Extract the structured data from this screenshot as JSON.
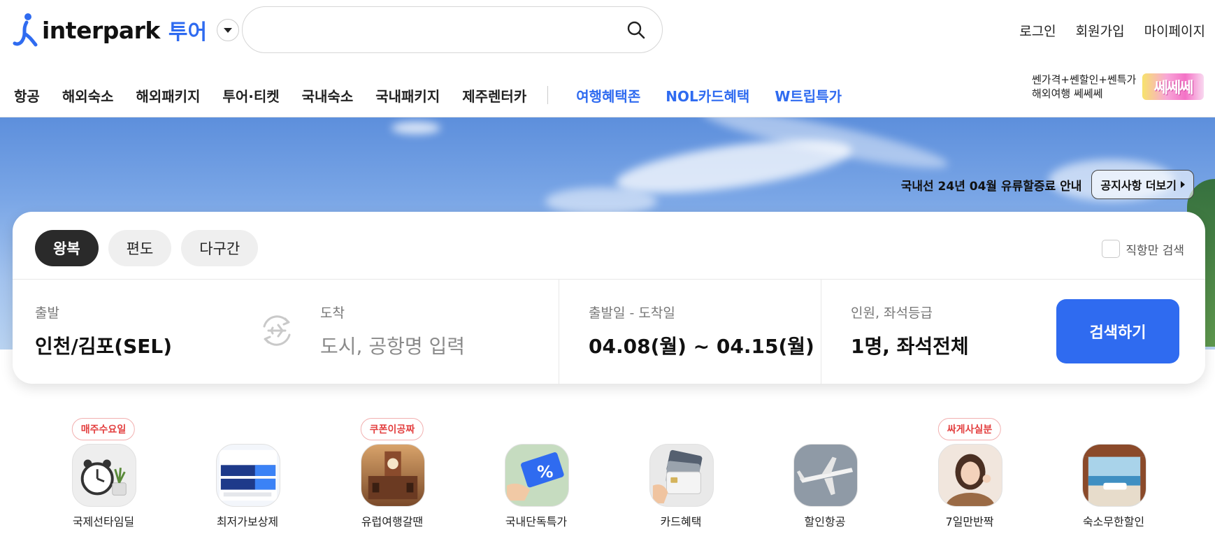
{
  "header": {
    "logo_text": "interpark",
    "logo_sub": "투어",
    "search_placeholder": "",
    "user_links": [
      "로그인",
      "회원가입",
      "마이페이지"
    ]
  },
  "nav": {
    "items": [
      "항공",
      "해외숙소",
      "해외패키지",
      "투어·티켓",
      "국내숙소",
      "국내패키지",
      "제주렌터카"
    ],
    "highlight_items": [
      "여행혜택존",
      "NOL카드혜택",
      "W트립특가"
    ],
    "promo_line1": "쎈가격+쎈할인+쎈특가",
    "promo_line2": "해외여행 쎄쎄쎄",
    "promo_badge": "쎄쎄쎄"
  },
  "notice": {
    "text": "국내선 24년 04월 유류할증료 안내",
    "button": "공지사항 더보기"
  },
  "search_panel": {
    "tabs": [
      "왕복",
      "편도",
      "다구간"
    ],
    "active_tab": "왕복",
    "direct_only": "직항만 검색",
    "departure_label": "출발",
    "departure_value": "인천/김포(SEL)",
    "arrival_label": "도착",
    "arrival_placeholder": "도시, 공항명 입력",
    "dates_label": "출발일 - 도착일",
    "dates_value": "04.08(월) ~ 04.15(월)",
    "passengers_label": "인원, 좌석등급",
    "passengers_value": "1명, 좌석전체",
    "search_button": "검색하기"
  },
  "quick_menu": [
    {
      "label": "국제선타임딜",
      "badge": "매주수요일"
    },
    {
      "label": "최저가보상제",
      "badge": ""
    },
    {
      "label": "유럽여행갈땐",
      "badge": "쿠폰이공짜"
    },
    {
      "label": "국내단독특가",
      "badge": ""
    },
    {
      "label": "카드혜택",
      "badge": ""
    },
    {
      "label": "할인항공",
      "badge": ""
    },
    {
      "label": "7일만반짝",
      "badge": "싸게사실분"
    },
    {
      "label": "숙소무한할인",
      "badge": ""
    }
  ],
  "colors": {
    "brand_blue": "#2f6bf0",
    "active_tab": "#2a2a2a",
    "badge_red": "#e34040"
  },
  "icons": {
    "search": "search-icon",
    "swap": "swap-plane-icon",
    "dropdown": "chevron-down-icon"
  }
}
